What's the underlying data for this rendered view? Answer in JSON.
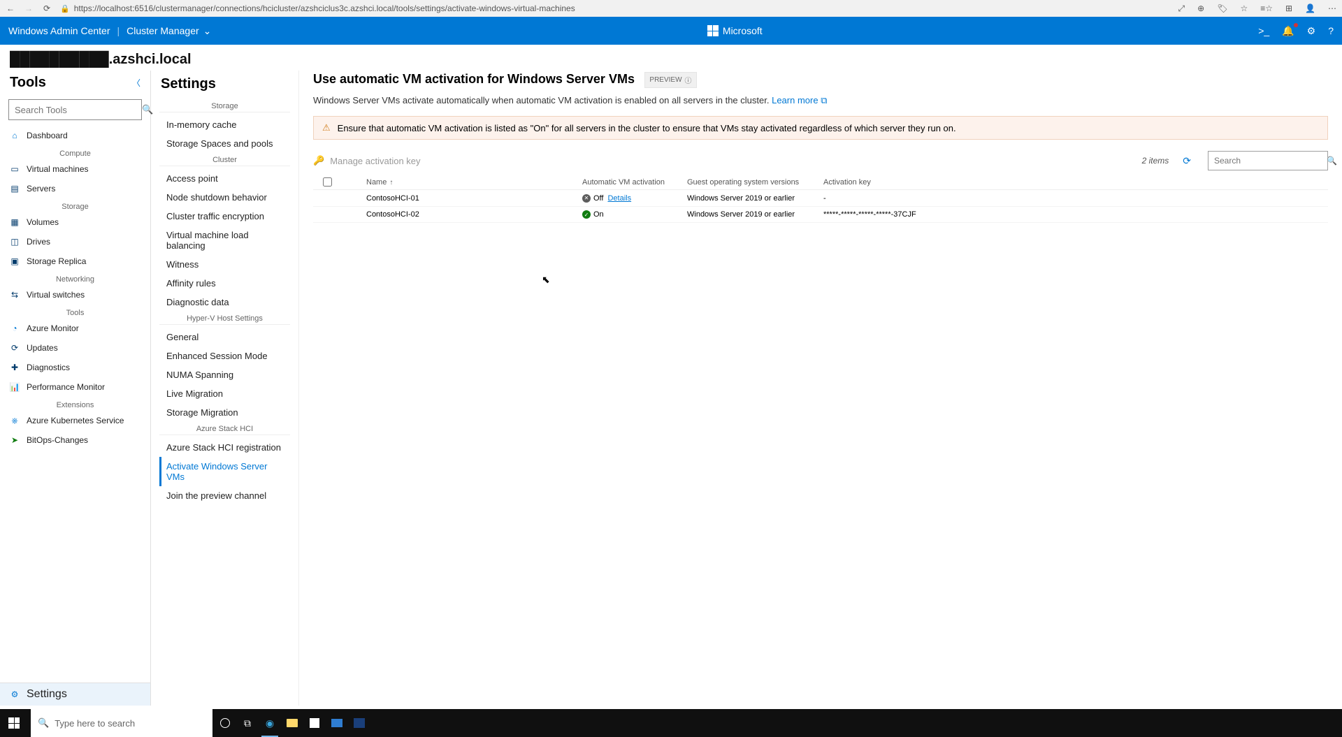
{
  "browser": {
    "url": "https://localhost:6516/clustermanager/connections/hcicluster/azshciclus3c.azshci.local/tools/settings/activate-windows-virtual-machines"
  },
  "topbar": {
    "wac": "Windows Admin Center",
    "cm": "Cluster Manager",
    "microsoft": "Microsoft"
  },
  "cluster_name": "██████████.azshci.local",
  "tools": {
    "title": "Tools",
    "search_placeholder": "Search Tools",
    "groups": {
      "compute": "Compute",
      "storage": "Storage",
      "networking": "Networking",
      "tools": "Tools",
      "extensions": "Extensions"
    },
    "items": {
      "dashboard": "Dashboard",
      "vms": "Virtual machines",
      "servers": "Servers",
      "volumes": "Volumes",
      "drives": "Drives",
      "storage_replica": "Storage Replica",
      "virtual_switches": "Virtual switches",
      "azure_monitor": "Azure Monitor",
      "updates": "Updates",
      "diagnostics": "Diagnostics",
      "perf_monitor": "Performance Monitor",
      "aks": "Azure Kubernetes Service",
      "bitops": "BitOps-Changes",
      "settings": "Settings"
    }
  },
  "settings": {
    "title": "Settings",
    "groups": {
      "storage": "Storage",
      "cluster": "Cluster",
      "hyperv": "Hyper-V Host Settings",
      "azurestack": "Azure Stack HCI"
    },
    "items": {
      "inmem": "In-memory cache",
      "pools": "Storage Spaces and pools",
      "access_point": "Access point",
      "node_shutdown": "Node shutdown behavior",
      "traffic_enc": "Cluster traffic encryption",
      "vm_load": "Virtual machine load balancing",
      "witness": "Witness",
      "affinity": "Affinity rules",
      "diag": "Diagnostic data",
      "general": "General",
      "enhanced": "Enhanced Session Mode",
      "numa": "NUMA Spanning",
      "livemig": "Live Migration",
      "storagemig": "Storage Migration",
      "azreg": "Azure Stack HCI registration",
      "activate": "Activate Windows Server VMs",
      "preview_channel": "Join the preview channel"
    }
  },
  "content": {
    "heading": "Use automatic VM activation for Windows Server VMs",
    "preview": "PREVIEW",
    "subtitle": "Windows Server VMs activate automatically when automatic VM activation is enabled on all servers in the cluster.",
    "learn_more": "Learn more",
    "alert": "Ensure that automatic VM activation is listed as \"On\" for all servers in the cluster to ensure that VMs stay activated regardless of which server they run on.",
    "manage_key": "Manage activation key",
    "count": "2 items",
    "search_placeholder": "Search",
    "columns": {
      "name": "Name",
      "activation": "Automatic VM activation",
      "os": "Guest operating system versions",
      "key": "Activation key"
    },
    "rows": [
      {
        "name": "ContosoHCI-01",
        "status": "Off",
        "details": "Details",
        "os": "Windows Server 2019 or earlier",
        "key": "-"
      },
      {
        "name": "ContosoHCI-02",
        "status": "On",
        "os": "Windows Server 2019 or earlier",
        "key": "*****-*****-*****-*****-37CJF"
      }
    ]
  },
  "taskbar": {
    "search_placeholder": "Type here to search"
  }
}
